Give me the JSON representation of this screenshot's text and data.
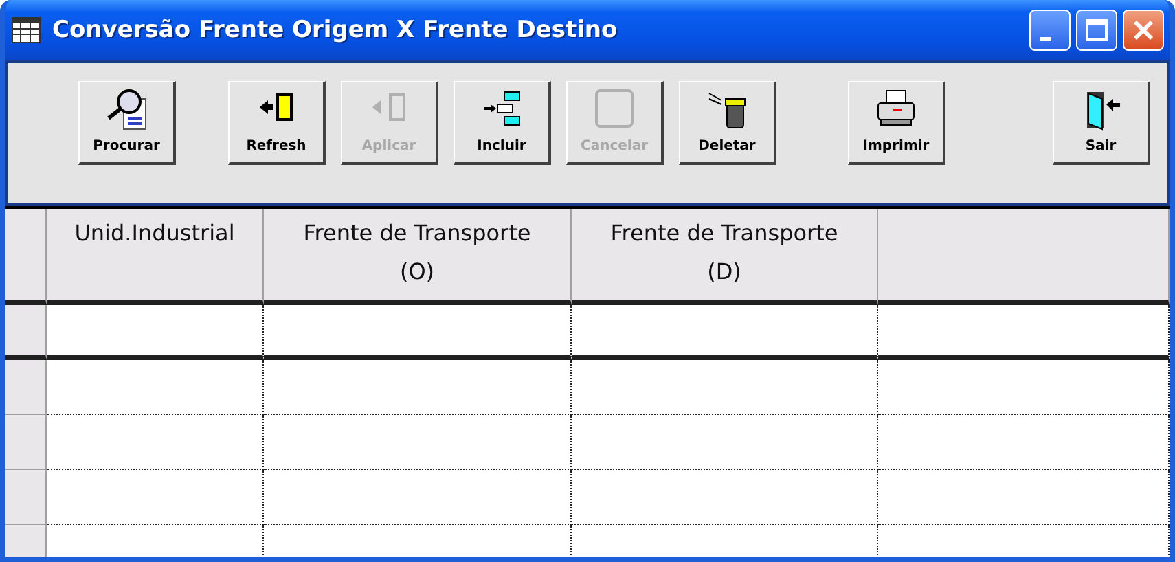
{
  "window": {
    "title": "Conversão Frente Origem X Frente Destino"
  },
  "toolbar": {
    "groups": [
      {
        "buttons": [
          {
            "label": "Procurar",
            "kind": "search",
            "disabled": false
          }
        ]
      },
      {
        "buttons": [
          {
            "label": "Refresh",
            "kind": "refresh",
            "disabled": false
          },
          {
            "label": "Aplicar",
            "kind": "apply",
            "disabled": true
          },
          {
            "label": "Incluir",
            "kind": "add",
            "disabled": false
          },
          {
            "label": "Cancelar",
            "kind": "cancel",
            "disabled": true
          },
          {
            "label": "Deletar",
            "kind": "delete",
            "disabled": false
          }
        ]
      },
      {
        "buttons": [
          {
            "label": "Imprimir",
            "kind": "print",
            "disabled": false
          }
        ]
      },
      {
        "buttons": [
          {
            "label": "Sair",
            "kind": "exit",
            "disabled": false
          }
        ]
      }
    ]
  },
  "table": {
    "columns": [
      {
        "label": "Unid.Industrial"
      },
      {
        "label": "Frente de Transporte\n(O)"
      },
      {
        "label": "Frente de Transporte\n(D)"
      }
    ]
  }
}
